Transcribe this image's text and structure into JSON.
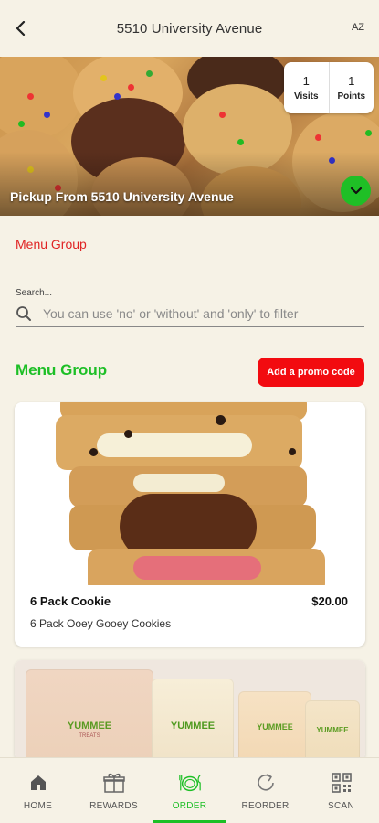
{
  "header": {
    "title": "5510 University Avenue",
    "sort_label": "AZ"
  },
  "hero": {
    "pickup_text": "Pickup From 5510 University Avenue",
    "visits": {
      "count": "1",
      "label": "Visits"
    },
    "points": {
      "count": "1",
      "label": "Points"
    }
  },
  "menu_group_link": "Menu Group",
  "search": {
    "label": "Search...",
    "placeholder": "You can use 'no' or 'without' and 'only' to filter"
  },
  "section": {
    "title": "Menu Group",
    "promo_button": "Add a promo code"
  },
  "products": [
    {
      "name": "6 Pack Cookie",
      "price": "$20.00",
      "description": "6 Pack Ooey Gooey Cookies"
    },
    {
      "brand_text": "YUMMEE",
      "brand_sub": "TREATS"
    }
  ],
  "nav": [
    {
      "label": "HOME",
      "icon": "home-icon"
    },
    {
      "label": "REWARDS",
      "icon": "gift-icon"
    },
    {
      "label": "ORDER",
      "icon": "plate-icon",
      "active": true
    },
    {
      "label": "REORDER",
      "icon": "refresh-icon"
    },
    {
      "label": "SCAN",
      "icon": "qr-icon"
    }
  ],
  "colors": {
    "background": "#f6f2e6",
    "accent_green": "#1dbf26",
    "accent_red": "#f20b10",
    "link_red": "#e02424"
  }
}
